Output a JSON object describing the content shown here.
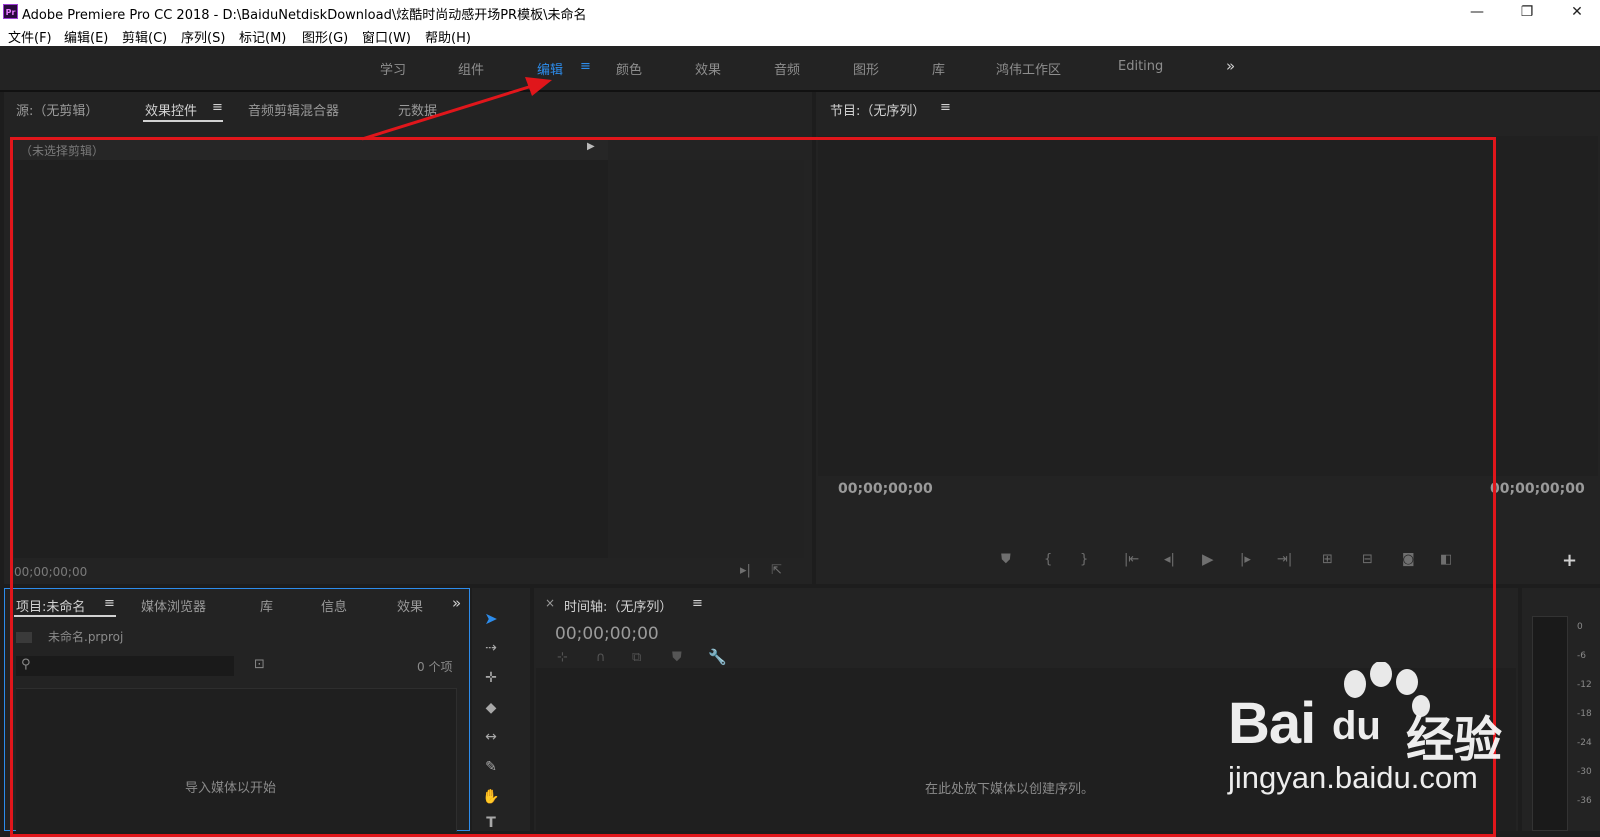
{
  "window": {
    "logo": "Pr",
    "title": "Adobe Premiere Pro CC 2018 - D:\\BaiduNetdiskDownload\\炫酷时尚动感开场PR模板\\未命名",
    "minimize": "—",
    "restore": "❐",
    "close": "✕"
  },
  "menu": [
    "文件(F)",
    "编辑(E)",
    "剪辑(C)",
    "序列(S)",
    "标记(M)",
    "图形(G)",
    "窗口(W)",
    "帮助(H)"
  ],
  "workspaces": {
    "tabs": [
      "学习",
      "组件",
      "编辑",
      "颜色",
      "效果",
      "音频",
      "图形",
      "库",
      "鸿伟工作区",
      "Editing"
    ],
    "active": "编辑",
    "menu_icon": "≡",
    "overflow": "»"
  },
  "source_panel": {
    "tabs": [
      "源:（无剪辑）",
      "效果控件",
      "音频剪辑混合器",
      "元数据"
    ],
    "active_tab": "效果控件",
    "menu_icon": "≡",
    "clip_label": "（未选择剪辑）",
    "timecode": "00;00;00;00"
  },
  "program_panel": {
    "title": "节目:（无序列）",
    "menu_icon": "≡",
    "timecode_left": "00;00;00;00",
    "timecode_right": "00;00;00;00",
    "add_icon": "+"
  },
  "project_panel": {
    "tabs": [
      "项目:未命名",
      "媒体浏览器",
      "库",
      "信息",
      "效果"
    ],
    "active_tab": "项目:未命名",
    "menu_icon": "≡",
    "overflow": "»",
    "project_file": "未命名.prproj",
    "item_count": "0 个项",
    "empty_message": "导入媒体以开始"
  },
  "timeline_panel": {
    "close": "×",
    "title": "时间轴:（无序列）",
    "menu_icon": "≡",
    "timecode": "00;00;00;00",
    "empty_message": "在此处放下媒体以创建序列。"
  },
  "audio_meter": {
    "labels": [
      "0",
      "-6",
      "-12",
      "-18",
      "-24",
      "-30",
      "-36"
    ]
  },
  "watermark": {
    "brand": "Bai",
    "brand_du": "du",
    "brand_cn": "经验",
    "url": "jingyan.baidu.com"
  },
  "colors": {
    "accent_blue": "#2d8ceb",
    "annotation_red": "#e0161b",
    "panel_bg": "#232323"
  }
}
